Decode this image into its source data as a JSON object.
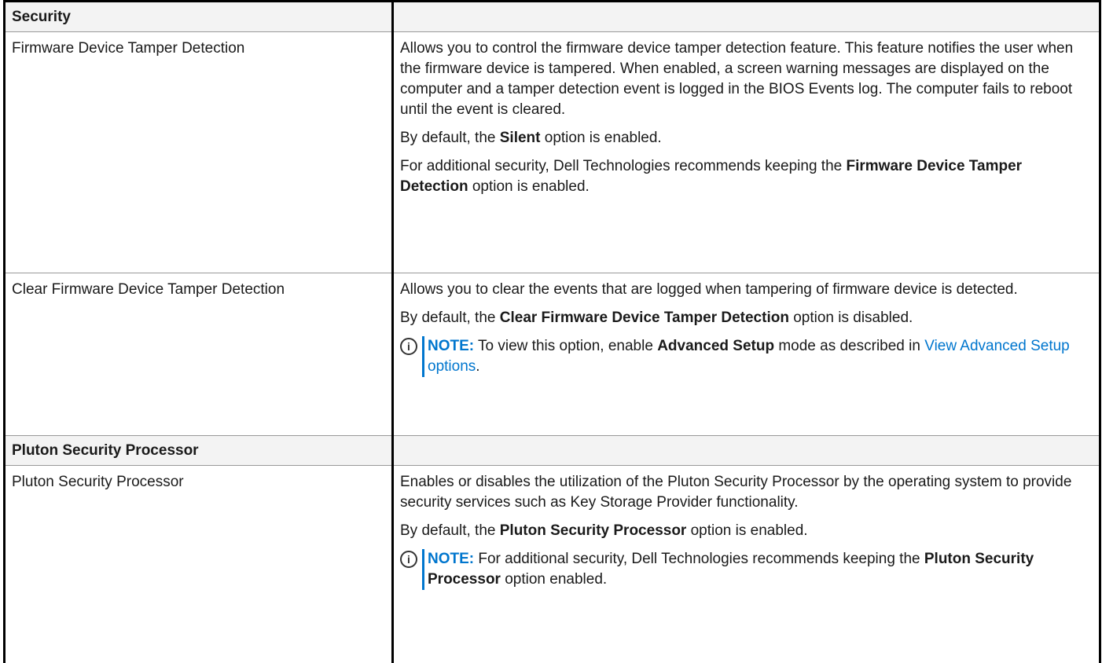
{
  "sections": [
    {
      "title": "Security"
    },
    {
      "title": "Pluton Security Processor"
    }
  ],
  "rows": {
    "fdtd": {
      "label": "Firmware Device Tamper Detection",
      "p1": "Allows you to control the firmware device tamper detection feature. This feature notifies the user when the firmware device is tampered. When enabled, a screen warning messages are displayed on the computer and a tamper detection event is logged in the BIOS Events log. The computer fails to reboot until the event is cleared.",
      "p2_a": "By default, the ",
      "p2_b": "Silent",
      "p2_c": " option is enabled.",
      "p3_a": "For additional security, Dell Technologies recommends keeping the ",
      "p3_b": "Firmware Device Tamper Detection",
      "p3_c": " option is enabled."
    },
    "cfdtd": {
      "label": "Clear Firmware Device Tamper Detection",
      "p1": "Allows you to clear the events that are logged when tampering of firmware device is detected.",
      "p2_a": "By default, the ",
      "p2_b": "Clear Firmware Device Tamper Detection",
      "p2_c": " option is disabled.",
      "note_label": "NOTE:",
      "note_a": " To view this option, enable ",
      "note_b": "Advanced Setup",
      "note_c": " mode as described in ",
      "note_link": "View Advanced Setup options",
      "note_d": "."
    },
    "psp": {
      "label": "Pluton Security Processor",
      "p1": "Enables or disables the utilization of the Pluton Security Processor by the operating system to provide security services such as Key Storage Provider functionality.",
      "p2_a": "By default, the ",
      "p2_b": "Pluton Security Processor",
      "p2_c": " option is enabled.",
      "note_label": "NOTE:",
      "note_a": " For additional security, Dell Technologies recommends keeping the ",
      "note_b": "Pluton Security Processor",
      "note_c": " option enabled."
    }
  },
  "icons": {
    "note_icon": "i"
  },
  "colors": {
    "accent": "#0076ce",
    "section_bg": "#f3f3f3"
  }
}
